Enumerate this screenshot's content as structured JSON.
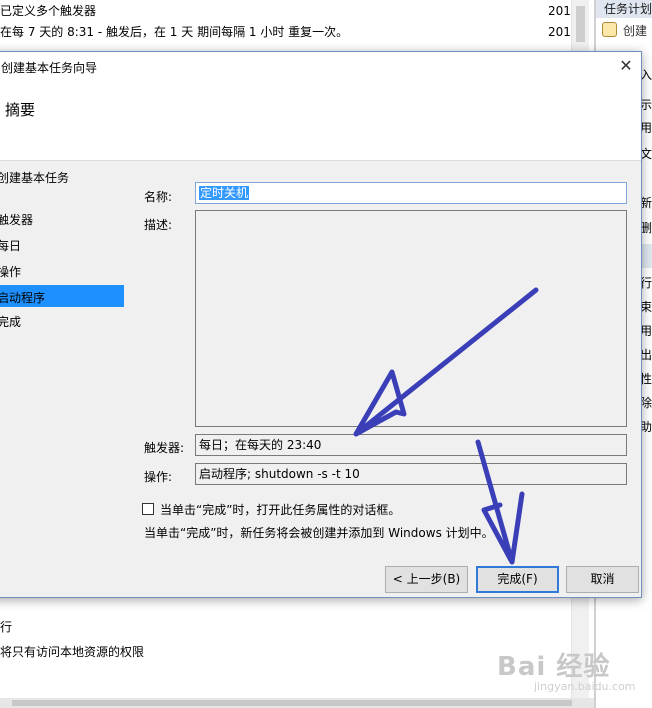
{
  "background": {
    "rows": [
      {
        "text": "已定义多个触发器",
        "year": "201"
      },
      {
        "text": "在每 7 天的 8:31 - 触发后，在 1 天 期间每隔 1 小时 重复一次。",
        "year": "201"
      }
    ],
    "lower_rows": [
      "行",
      "将只有访问本地资源的权限"
    ]
  },
  "right_pane": {
    "header": "任务计划",
    "create_label": "创建",
    "items": [
      "入",
      "示",
      "用",
      "文",
      "新",
      "删",
      "行",
      "束",
      "用",
      "出",
      "性",
      "除",
      "助"
    ]
  },
  "dialog": {
    "title": "创建基本任务向导",
    "close_glyph": "✕",
    "heading": "摘要",
    "steps": [
      "创建基本任务",
      "触发器",
      "每日",
      "操作",
      "启动程序",
      "完成"
    ],
    "name_label": "名称:",
    "name_value": "定时关机",
    "description_label": "描述:",
    "trigger_label": "触发器:",
    "trigger_value": "每日；在每天的 23:40",
    "action_label": "操作:",
    "action_value": "启动程序; shutdown -s -t 10",
    "checkbox_label": "当单击“完成”时，打开此任务属性的对话框。",
    "info_text": "当单击“完成”时，新任务将会被创建并添加到 Windows 计划中。",
    "back_button": "< 上一步(B)",
    "finish_button": "完成(F)",
    "cancel_button": "取消"
  },
  "watermark": {
    "brand": "Bai 经验",
    "url": "jingyan.baidu.com"
  },
  "colors": {
    "accent": "#1e90ff",
    "annotation_arrow": "#3a3fb8",
    "selection": "#3399ff"
  }
}
